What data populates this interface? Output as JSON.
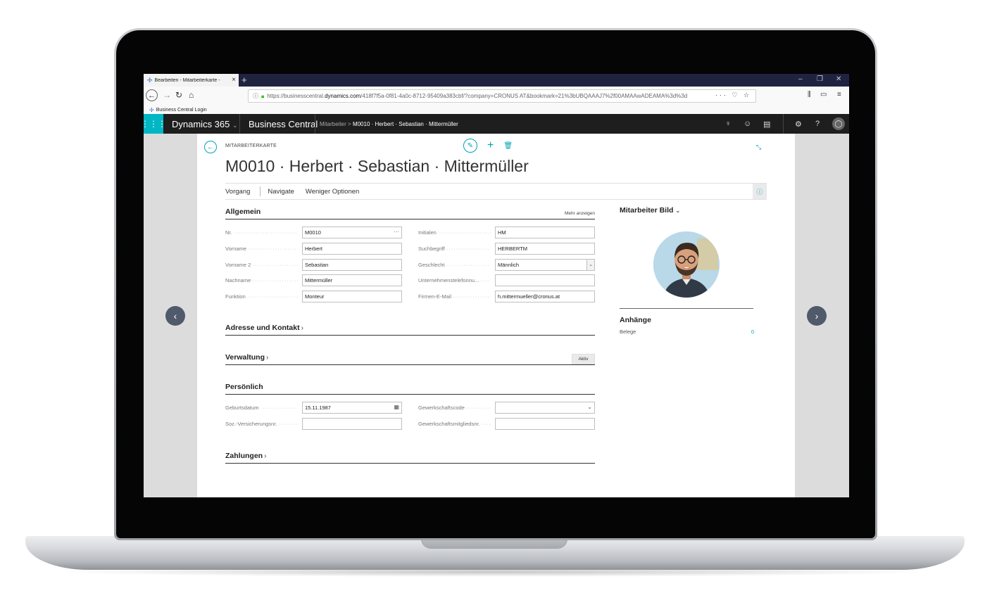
{
  "browser": {
    "tab_title": "Bearbeiten - Mitarbeiterkarte - ",
    "new_tab": "+",
    "url_prefix": "https://businesscentral.",
    "url_domain": "dynamics.com",
    "url_rest": "/418f7f5a-0f81-4a0c-8712-95409a383cbf/?company=CRONUS AT&bookmark=21%3bUBQAAAJ7%2f00AMAAwADEAMA%3d%3d",
    "url_tools": "··· ♡ ☆",
    "bookmark": "Business Central Login"
  },
  "bc_header": {
    "app": "Dynamics 365",
    "product": "Business Central",
    "breadcrumb_parent": "Mitarbeiter",
    "breadcrumb_current": "M0010 · Herbert · Sebastian · Mittermüller"
  },
  "card": {
    "caption": "MITARBEITERKARTE",
    "title": "M0010 · Herbert · Sebastian · Mittermüller",
    "actions": [
      "Vorgang",
      "Navigate",
      "Weniger Optionen"
    ]
  },
  "general": {
    "title": "Allgemein",
    "show_more": "Mehr anzeigen",
    "left_fields": [
      {
        "label": "Nr.",
        "value": "M0010"
      },
      {
        "label": "Vorname",
        "value": "Herbert"
      },
      {
        "label": "Vorname 2",
        "value": "Sebastian"
      },
      {
        "label": "Nachname",
        "value": "Mittermüller"
      },
      {
        "label": "Funktion",
        "value": "Monteur"
      }
    ],
    "right_fields": [
      {
        "label": "Initialen",
        "value": "HM"
      },
      {
        "label": "Suchbegriff",
        "value": "HERBERTM"
      },
      {
        "label": "Geschlecht",
        "value": "Männlich"
      },
      {
        "label": "Unternehmenstelefonnu...",
        "value": ""
      },
      {
        "label": "Firmen-E-Mail",
        "value": "h.mittermueller@cronus.at"
      }
    ]
  },
  "sections": {
    "address": "Adresse und Kontakt",
    "admin": "Verwaltung",
    "admin_badge": "Aktiv",
    "personal": "Persönlich",
    "payments": "Zahlungen"
  },
  "personal": {
    "left_fields": [
      {
        "label": "Geburtsdatum",
        "value": "15.11.1987"
      },
      {
        "label": "Soz.-Versicherungsnr.",
        "value": ""
      }
    ],
    "right_fields": [
      {
        "label": "Gewerkschaftscode",
        "value": ""
      },
      {
        "label": "Gewerkschaftsmitgliedsnr.",
        "value": ""
      }
    ]
  },
  "factbox": {
    "picture_title": "Mitarbeiter Bild",
    "attachments_title": "Anhänge",
    "attachments_label": "Belege",
    "attachments_count": "0"
  },
  "colors": {
    "accent": "#00a4b4",
    "header_bg": "#1e1e1e",
    "browser_tabbar": "#202340"
  }
}
